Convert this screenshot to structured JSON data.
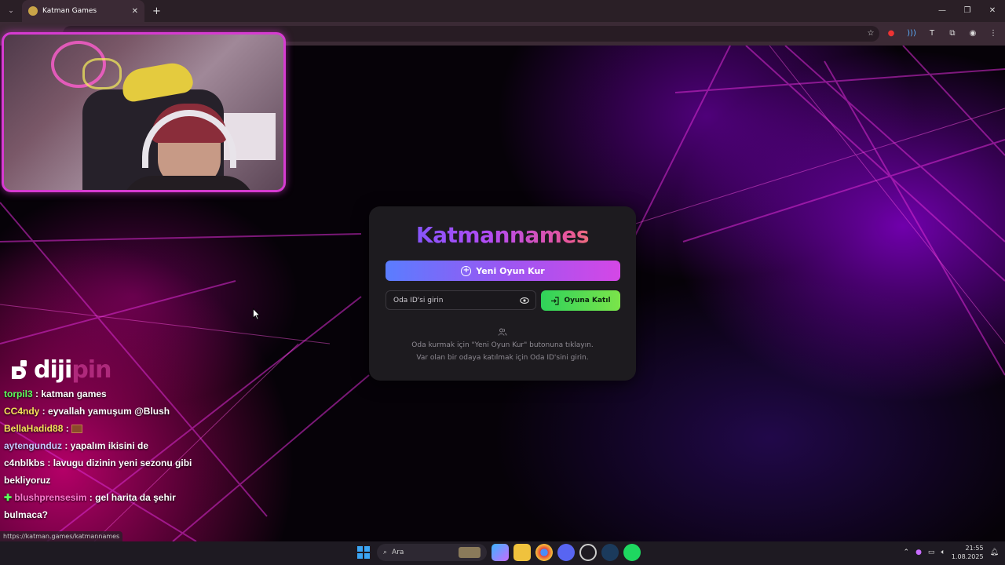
{
  "browser": {
    "tab_title": "Katman Games",
    "status_url": "https://katman.games/katmannames"
  },
  "game": {
    "logo": "Katmannames",
    "create_button": "Yeni Oyun Kur",
    "room_placeholder": "Oda ID'si girin",
    "join_button": "Oyuna Katıl",
    "hint_line1": "Oda kurmak için \"Yeni Oyun Kur\" butonuna tıklayın.",
    "hint_line2": "Var olan bir odaya katılmak için Oda ID'sini girin."
  },
  "overlay": {
    "brand": "diji",
    "brand_suffix": "pin",
    "chat": [
      {
        "user": "torpil3",
        "msg": "katman games"
      },
      {
        "user": "CC4ndy",
        "msg": "eyvallah yamuşum @Blush"
      },
      {
        "user": "BellaHadid88",
        "msg": ""
      },
      {
        "user": "aytengunduz",
        "msg": "yapalım ikisini de"
      },
      {
        "user": "c4nblkbs",
        "msg": "lavugu dizinin yeni sezonu gibi bekliyoruz"
      },
      {
        "user": "blushprensesim",
        "msg": "gel harita da şehir bulmaca?"
      }
    ]
  },
  "taskbar": {
    "search_label": "Ara",
    "time": "21:55",
    "date": "1.08.2025"
  },
  "colors": {
    "card_bg": "#1d1b1f",
    "create_gradient": [
      "#5a7dff",
      "#d447e6"
    ],
    "join_gradient": [
      "#2fd25a",
      "#7be44a"
    ],
    "cam_border": "#d63bd1"
  }
}
